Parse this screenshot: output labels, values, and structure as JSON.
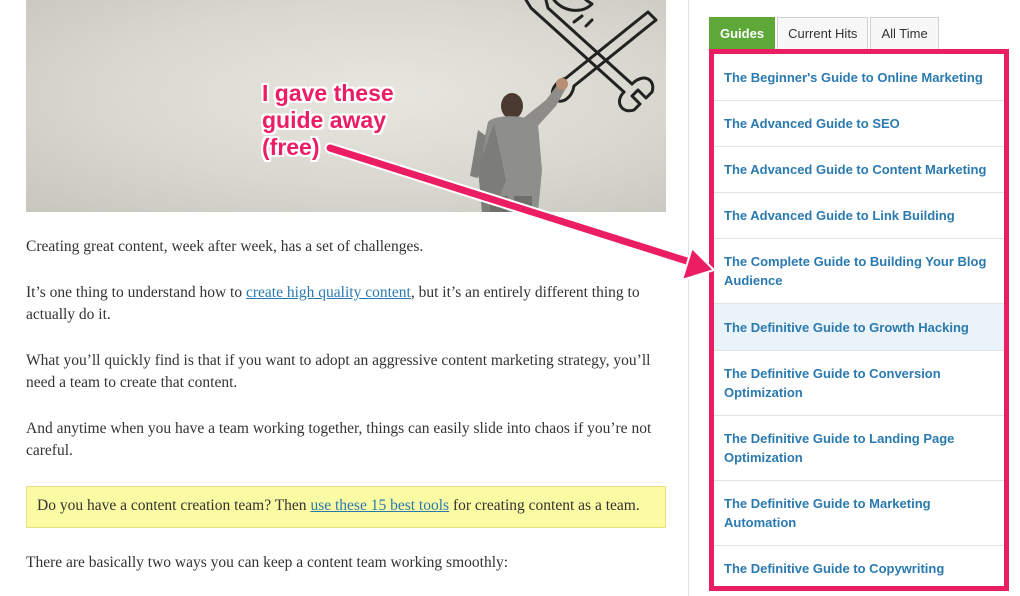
{
  "annotation": {
    "lines": [
      "I gave these",
      "guide away",
      "(free)"
    ],
    "color": "#ec1e63"
  },
  "article": {
    "p1": "Creating great content, week after week, has a set of challenges.",
    "p2_before": "It’s one thing to understand how to ",
    "p2_link": "create high quality content",
    "p2_after": ", but it’s an entirely different thing to actually do it.",
    "p3": "What you’ll quickly find is that if you want to adopt an aggressive content marketing strategy, you’ll need a team to create that content.",
    "p4": "And anytime when you have a team working together, things can easily slide into chaos if you’re not careful.",
    "callout_before": "Do you have a content creation team? Then ",
    "callout_link": "use these 15 best tools",
    "callout_after": " for creating content as a team.",
    "p5": "There are basically two ways you can keep a content team working smoothly:"
  },
  "sidebar": {
    "tabs": [
      "Guides",
      "Current Hits",
      "All Time"
    ],
    "active_tab": "Guides",
    "guides": [
      "The Beginner's Guide to Online Marketing",
      "The Advanced Guide to SEO",
      "The Advanced Guide to Content Marketing",
      "The Advanced Guide to Link Building",
      "The Complete Guide to Building Your Blog Audience",
      "The Definitive Guide to Growth Hacking",
      "The Definitive Guide to Conversion Optimization",
      "The Definitive Guide to Landing Page Optimization",
      "The Definitive Guide to Marketing Automation",
      "The Definitive Guide to Copywriting"
    ]
  },
  "colors": {
    "accent": "#ec1e63",
    "tab_active": "#5ea83a",
    "link": "#2a7ab0",
    "callout_bg": "#fbfba3"
  }
}
